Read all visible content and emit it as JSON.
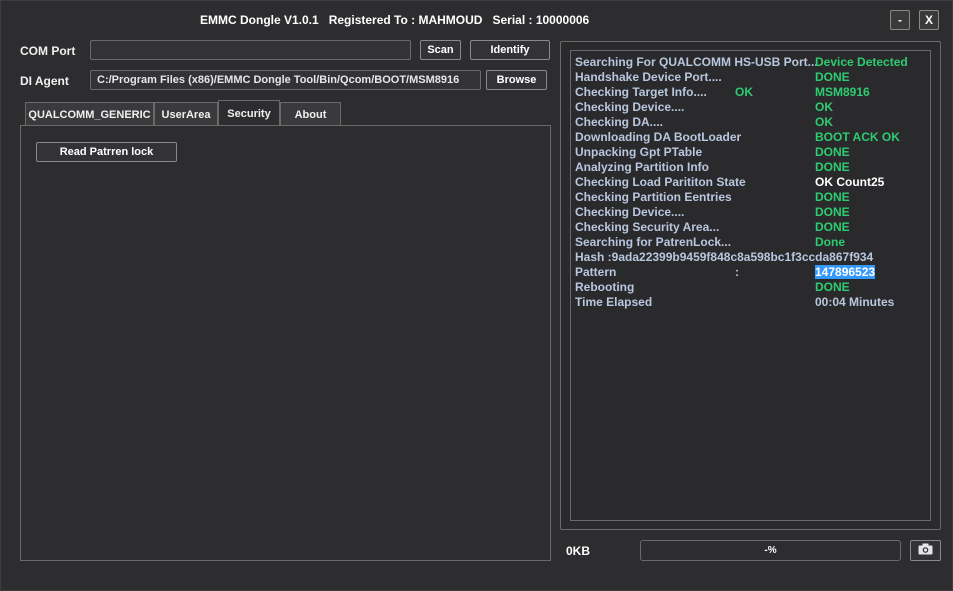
{
  "window": {
    "title": "EMMC Dongle V1.0.1   Registered To : MAHMOUD   Serial : 10000006",
    "minimize_label": "-",
    "close_label": "X"
  },
  "com_port": {
    "label": "COM Port",
    "value": ""
  },
  "da_agent": {
    "label": "DI  Agent",
    "value": "C:/Program Files (x86)/EMMC Dongle Tool/Bin/Qcom/BOOT/MSM8916"
  },
  "buttons": {
    "scan": "Scan",
    "identify": "Identify",
    "browse": "Browse"
  },
  "tabs": [
    "QUALCOMM_GENERIC",
    "UserArea",
    "Security",
    "About"
  ],
  "active_tab": "Security",
  "security": {
    "read_pattern_lock": "Read Patrren lock"
  },
  "log": [
    {
      "text": "Searching For QUALCOMM HS-USB Port...",
      "mid": "",
      "result": "Device Detected",
      "result_color": "green"
    },
    {
      "text": "Handshake Device Port....",
      "mid": "",
      "result": "DONE",
      "result_color": "green"
    },
    {
      "text": "Checking Target Info....",
      "mid": "OK",
      "result": "MSM8916",
      "result_color": "green"
    },
    {
      "text": "Checking Device....",
      "mid": "",
      "result": "OK",
      "result_color": "green"
    },
    {
      "text": "Checking DA....",
      "mid": "",
      "result": "OK",
      "result_color": "green"
    },
    {
      "text": "Downloading DA BootLoader",
      "mid": "",
      "result": "BOOT ACK OK",
      "result_color": "green"
    },
    {
      "text": "Unpacking Gpt PTable",
      "mid": "",
      "result": "DONE",
      "result_color": "green"
    },
    {
      "text": "Analyzing Partition Info",
      "mid": "",
      "result": "DONE",
      "result_color": "green"
    },
    {
      "text": "Checking Load Parititon State",
      "mid": "",
      "result": "OK Count25",
      "result_color": "white"
    },
    {
      "text": "Checking Partition Eentries",
      "mid": "",
      "result": "DONE",
      "result_color": "green"
    },
    {
      "text": "Checking Device....",
      "mid": "",
      "result": "DONE",
      "result_color": "green"
    },
    {
      "text": "Checking Security Area...",
      "mid": "",
      "result": "DONE",
      "result_color": "green"
    },
    {
      "text": "Searching for PatrenLock...",
      "mid": "",
      "result": "Done",
      "result_color": "green"
    },
    {
      "text": "Hash :9ada22399b9459f848c8a598bc1f3ccda867f934",
      "mid": "",
      "result": "",
      "result_color": "key"
    },
    {
      "text": "Pattern",
      "mid": ":",
      "result": "147896523",
      "result_color": "highlight"
    },
    {
      "text": "Rebooting",
      "mid": "",
      "result": "DONE",
      "result_color": "green"
    },
    {
      "text": "Time Elapsed",
      "mid": "",
      "result": "00:04  Minutes",
      "result_color": "key"
    }
  ],
  "status": {
    "size": "0KB",
    "progress_text": "-%",
    "progress": 0
  },
  "colors": {
    "background": "#2d2d30",
    "green": "#2ecc71",
    "key": "#b8c7de",
    "highlight": "#3399ff"
  },
  "icons": {
    "camera": "camera-icon"
  }
}
